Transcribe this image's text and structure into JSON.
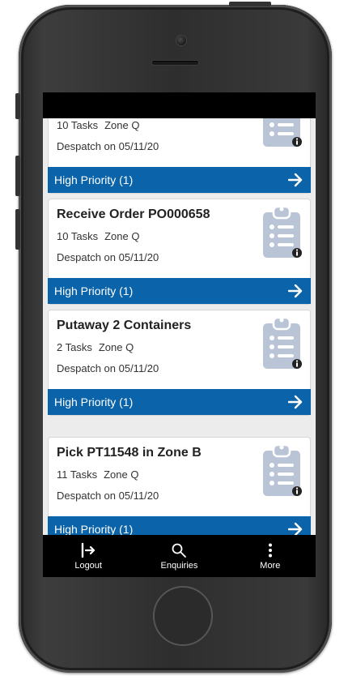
{
  "cards": [
    {
      "title": "",
      "tasks": "10 Tasks",
      "zone": "Zone Q",
      "despatch": "Despatch on 05/11/20",
      "priority": "High Priority (1)",
      "icon": "clipboard-info-icon"
    },
    {
      "title": "Receive Order PO000658",
      "tasks": "10 Tasks",
      "zone": "Zone Q",
      "despatch": "Despatch on 05/11/20",
      "priority": "High Priority (1)",
      "icon": "clipboard-info-icon"
    },
    {
      "title": "Putaway 2 Containers",
      "tasks": "2 Tasks",
      "zone": "Zone Q",
      "despatch": "Despatch on 05/11/20",
      "priority": "High Priority (1)",
      "icon": "clipboard-info-icon"
    },
    {
      "title": "Pick PT11548 in Zone B",
      "tasks": "11 Tasks",
      "zone": "Zone Q",
      "despatch": "Despatch on 05/11/20",
      "priority": "High Priority (1)",
      "icon": "clipboard-info-icon"
    }
  ],
  "nav": {
    "logout": "Logout",
    "enquiries": "Enquiries",
    "more": "More"
  },
  "colors": {
    "priority_bar": "#0b63a9",
    "clipboard": "#b9c4d6",
    "background": "#ececec"
  }
}
